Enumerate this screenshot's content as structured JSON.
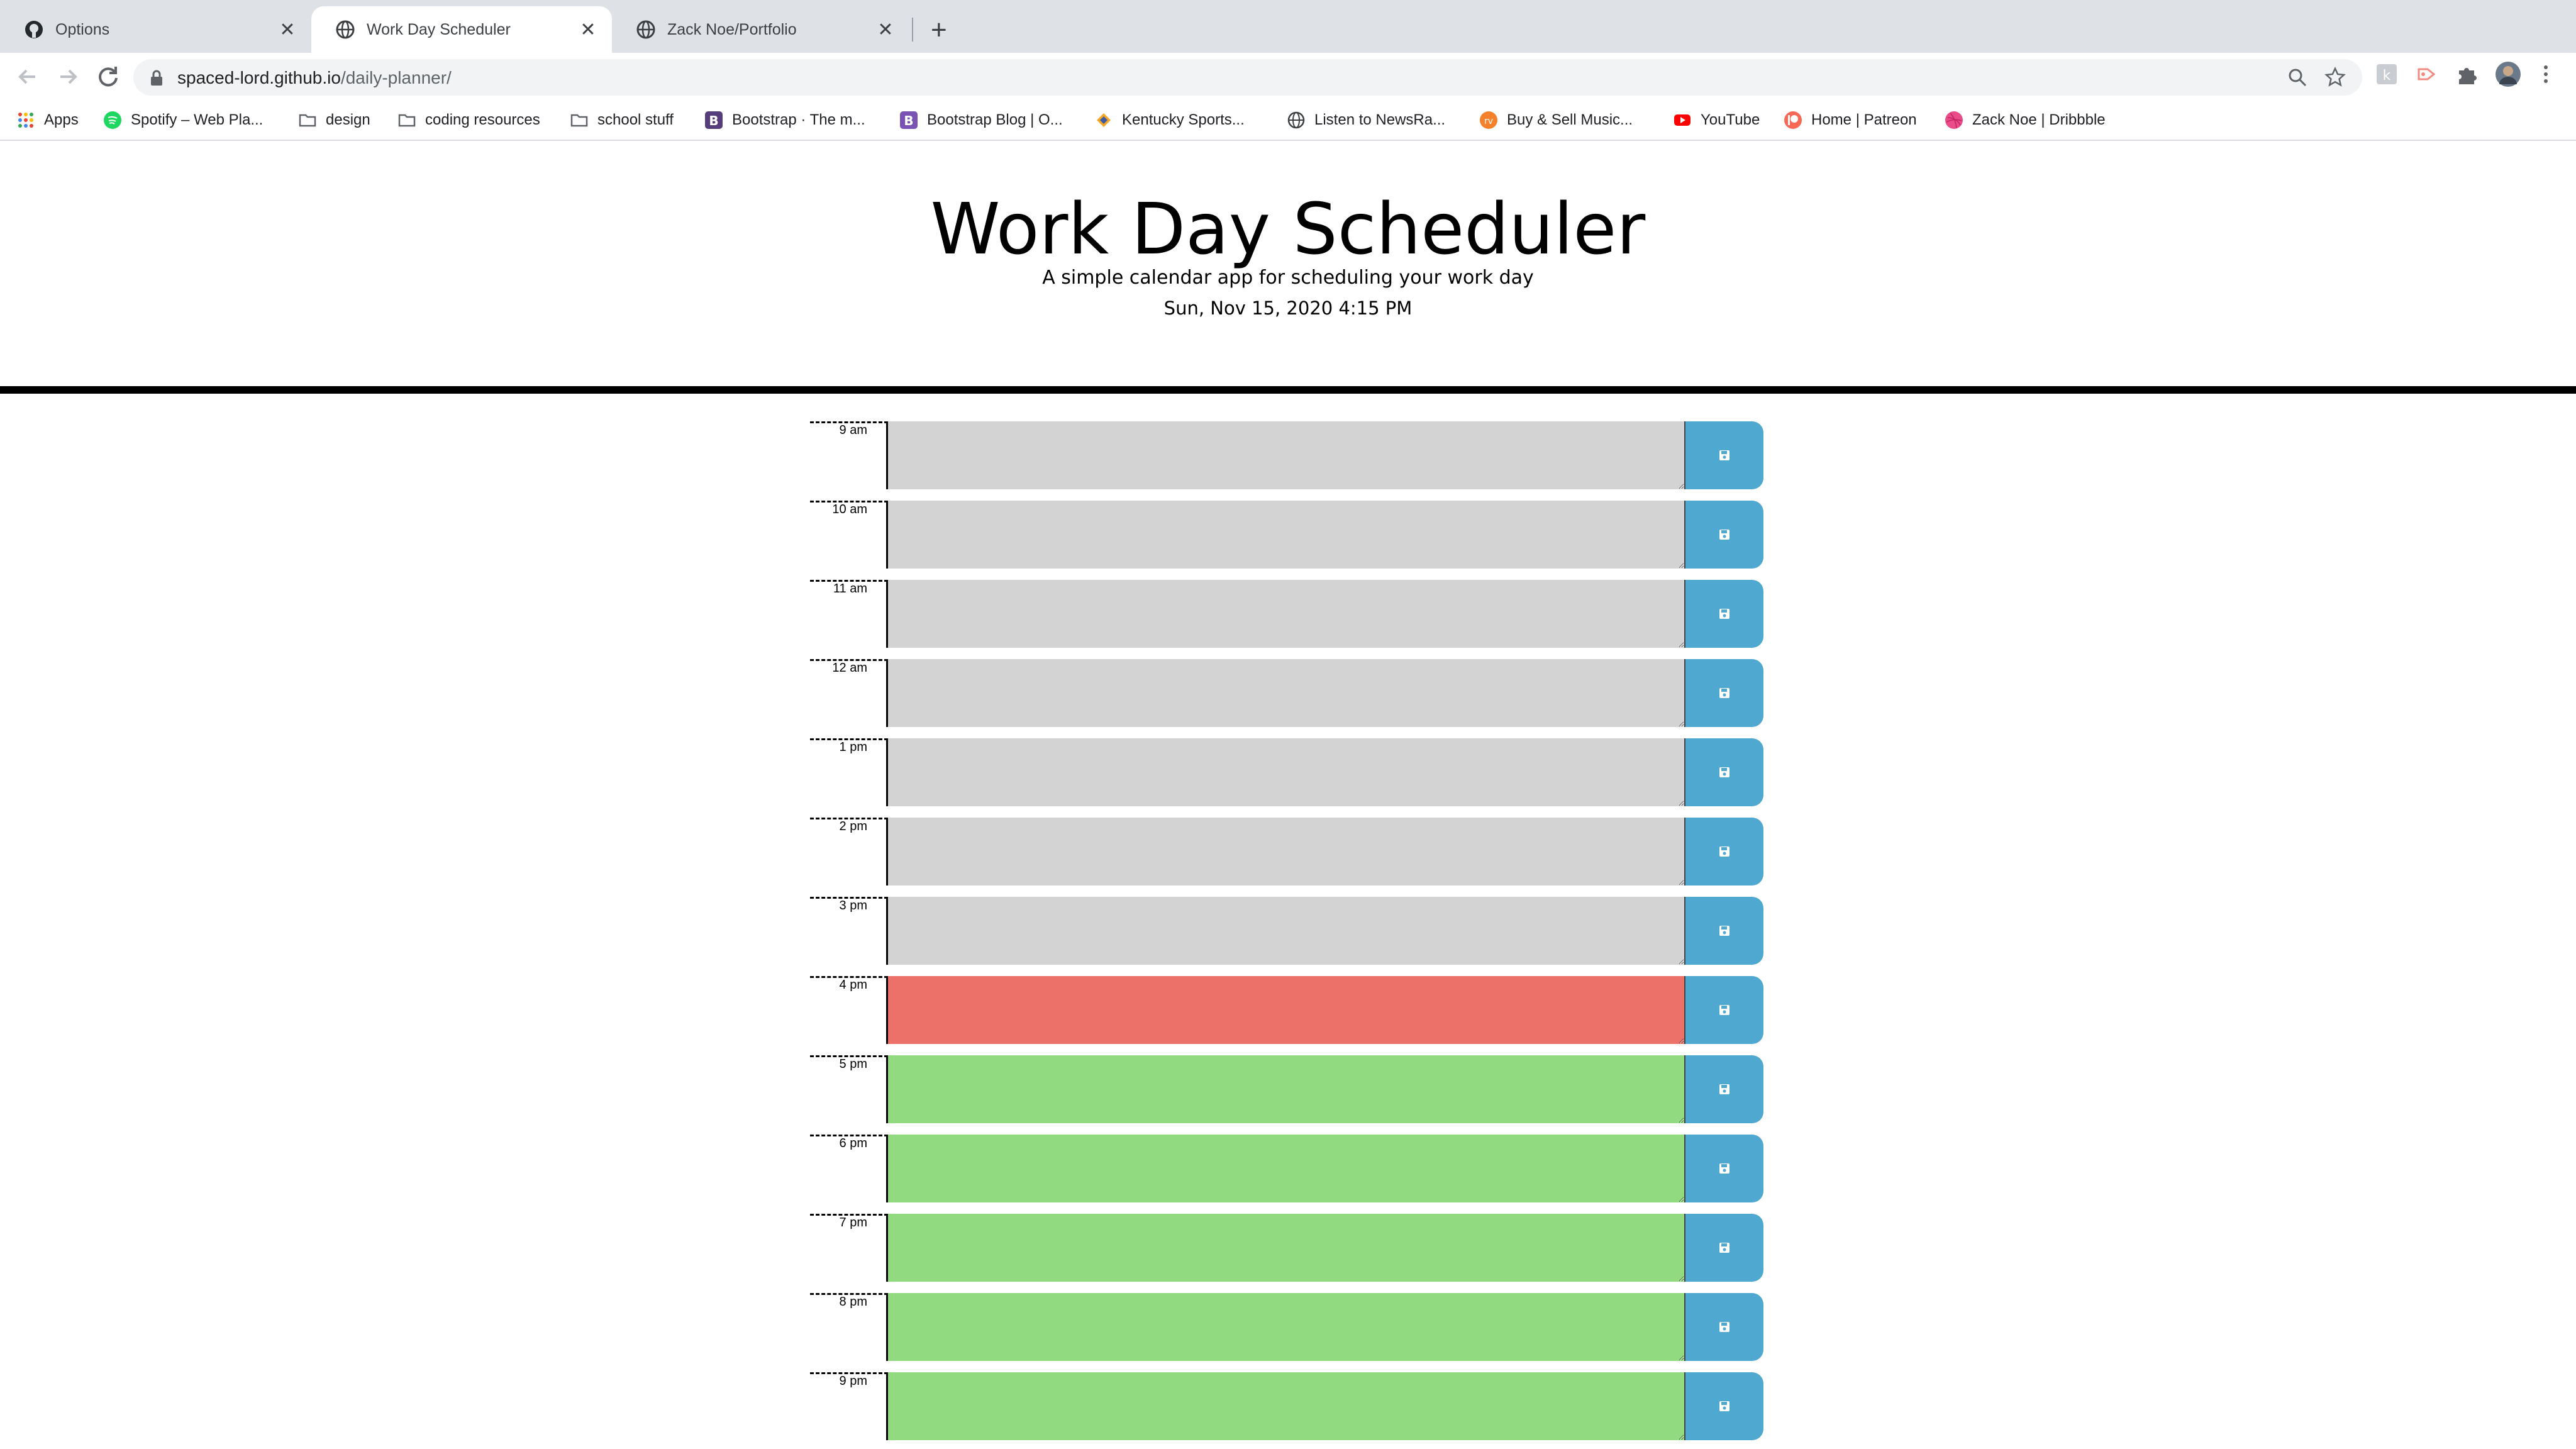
{
  "browser": {
    "tabs": [
      {
        "title": "Options",
        "icon": "github-icon",
        "active": false
      },
      {
        "title": "Work Day Scheduler",
        "icon": "globe-icon",
        "active": true
      },
      {
        "title": "Zack Noe/Portfolio",
        "icon": "globe-icon",
        "active": false
      }
    ],
    "url_host": "spaced-lord.github.io",
    "url_path": "/daily-planner/",
    "bookmarks": [
      {
        "label": "Apps",
        "icon": "apps-grid-icon"
      },
      {
        "label": "Spotify – Web Pla...",
        "icon": "spotify-icon"
      },
      {
        "label": "design",
        "icon": "folder-icon"
      },
      {
        "label": "coding resources",
        "icon": "folder-icon"
      },
      {
        "label": "school stuff",
        "icon": "folder-icon"
      },
      {
        "label": "Bootstrap · The m...",
        "icon": "bootstrap-icon"
      },
      {
        "label": "Bootstrap Blog | O...",
        "icon": "bootstrap-icon"
      },
      {
        "label": "Kentucky Sports...",
        "icon": "kentucky-icon"
      },
      {
        "label": "Listen to NewsRa...",
        "icon": "globe-icon"
      },
      {
        "label": "Buy & Sell Music...",
        "icon": "reverb-icon"
      },
      {
        "label": "YouTube",
        "icon": "youtube-icon"
      },
      {
        "label": "Home | Patreon",
        "icon": "patreon-icon"
      },
      {
        "label": "Zack Noe | Dribbble",
        "icon": "dribbble-icon"
      }
    ]
  },
  "header": {
    "title": "Work Day Scheduler",
    "subtitle": "A simple calendar app for scheduling your work day",
    "current_day": "Sun, Nov 15, 2020 4:15 PM"
  },
  "schedule": {
    "rows": [
      {
        "hour": "9 am",
        "status": "past",
        "text": ""
      },
      {
        "hour": "10 am",
        "status": "past",
        "text": ""
      },
      {
        "hour": "11 am",
        "status": "past",
        "text": ""
      },
      {
        "hour": "12 am",
        "status": "past",
        "text": ""
      },
      {
        "hour": "1 pm",
        "status": "past",
        "text": ""
      },
      {
        "hour": "2 pm",
        "status": "past",
        "text": ""
      },
      {
        "hour": "3 pm",
        "status": "past",
        "text": ""
      },
      {
        "hour": "4 pm",
        "status": "present",
        "text": ""
      },
      {
        "hour": "5 pm",
        "status": "future",
        "text": ""
      },
      {
        "hour": "6 pm",
        "status": "future",
        "text": ""
      },
      {
        "hour": "7 pm",
        "status": "future",
        "text": ""
      },
      {
        "hour": "8 pm",
        "status": "future",
        "text": ""
      },
      {
        "hour": "9 pm",
        "status": "future",
        "text": ""
      }
    ]
  },
  "colors": {
    "past": "#d3d3d3",
    "present": "#ec7168",
    "future": "#92da80",
    "save_button": "#4fa8d0"
  }
}
